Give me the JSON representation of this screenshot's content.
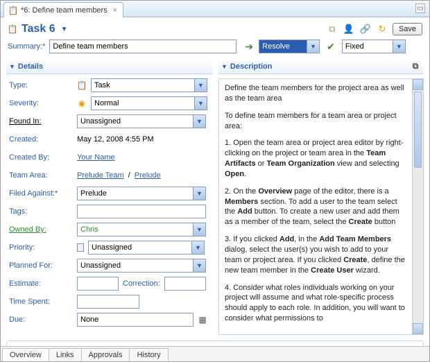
{
  "window": {
    "tab_title": "*6: Define team members",
    "pin_glyph": "▭"
  },
  "header": {
    "title": "Task 6",
    "icons": {
      "task": "📋",
      "i1_name": "copy-id-icon",
      "i2_name": "assign-icon",
      "i3_name": "link-icon",
      "i4_name": "refresh-icon"
    },
    "save_label": "Save"
  },
  "summary": {
    "label": "Summary:*",
    "value": "Define team members",
    "action_combo": "Resolve",
    "state_combo": "Fixed"
  },
  "details": {
    "section_title": "Details",
    "rows": {
      "type": {
        "label": "Type:",
        "value": "Task"
      },
      "severity": {
        "label": "Severity:",
        "value": "Normal"
      },
      "found_in": {
        "label": "Found In:",
        "value": "Unassigned"
      },
      "created": {
        "label": "Created:",
        "value": "May 12, 2008 4:55 PM"
      },
      "created_by": {
        "label": "Created By:",
        "value": "Your Name"
      },
      "team_area": {
        "label": "Team Area:",
        "value1": "Prelude Team",
        "sep": " / ",
        "value2": "Prelude"
      },
      "filed_against": {
        "label": "Filed Against:*",
        "value": "Prelude"
      },
      "tags": {
        "label": "Tags:",
        "value": ""
      },
      "owned_by": {
        "label": "Owned By:",
        "value": "Chris"
      },
      "priority": {
        "label": "Priority:",
        "value": "Unassigned"
      },
      "planned_for": {
        "label": "Planned For:",
        "value": "Unassigned"
      },
      "estimate": {
        "label": "Estimate:",
        "value": "",
        "corr_label": "Correction:",
        "corr_value": ""
      },
      "time_spent": {
        "label": "Time Spent:",
        "value": ""
      },
      "due": {
        "label": "Due:",
        "value": "None"
      }
    }
  },
  "description": {
    "section_title": "Description",
    "p1": "Define the team members for the project area as well as the team area",
    "p2": "To define team members for a team area or project area:",
    "p3a": "1. Open the team area or project area editor by right-clicking on the project or team area in the ",
    "p3b": "Team Artifacts",
    "p3c": " or ",
    "p3d": "Team Organization",
    "p3e": " view and selecting ",
    "p3f": "Open",
    "p3g": ".",
    "p4a": "2. On the ",
    "p4b": "Overview",
    "p4c": " page of the editor, there is a ",
    "p4d": "Members",
    "p4e": " section. To add a user to the team select the ",
    "p4f": "Add",
    "p4g": " button. To create a new user and add them as a member of the team, select the ",
    "p4h": "Create",
    "p4i": " button",
    "p5a": "3. If you clicked ",
    "p5b": "Add",
    "p5c": ", in the ",
    "p5d": "Add Team Members",
    "p5e": " dialog, select the user(s) you wish to add to your team or project area. If you clicked ",
    "p5f": "Create",
    "p5g": ", define the new team member in the ",
    "p5h": "Create User",
    "p5i": " wizard.",
    "p6": "4. Consider what roles individuals working on your project will assume and what role-specific process should apply to each role. In addition, you will want to consider what permissions to"
  },
  "footer_tabs": [
    "Overview",
    "Links",
    "Approvals",
    "History"
  ]
}
